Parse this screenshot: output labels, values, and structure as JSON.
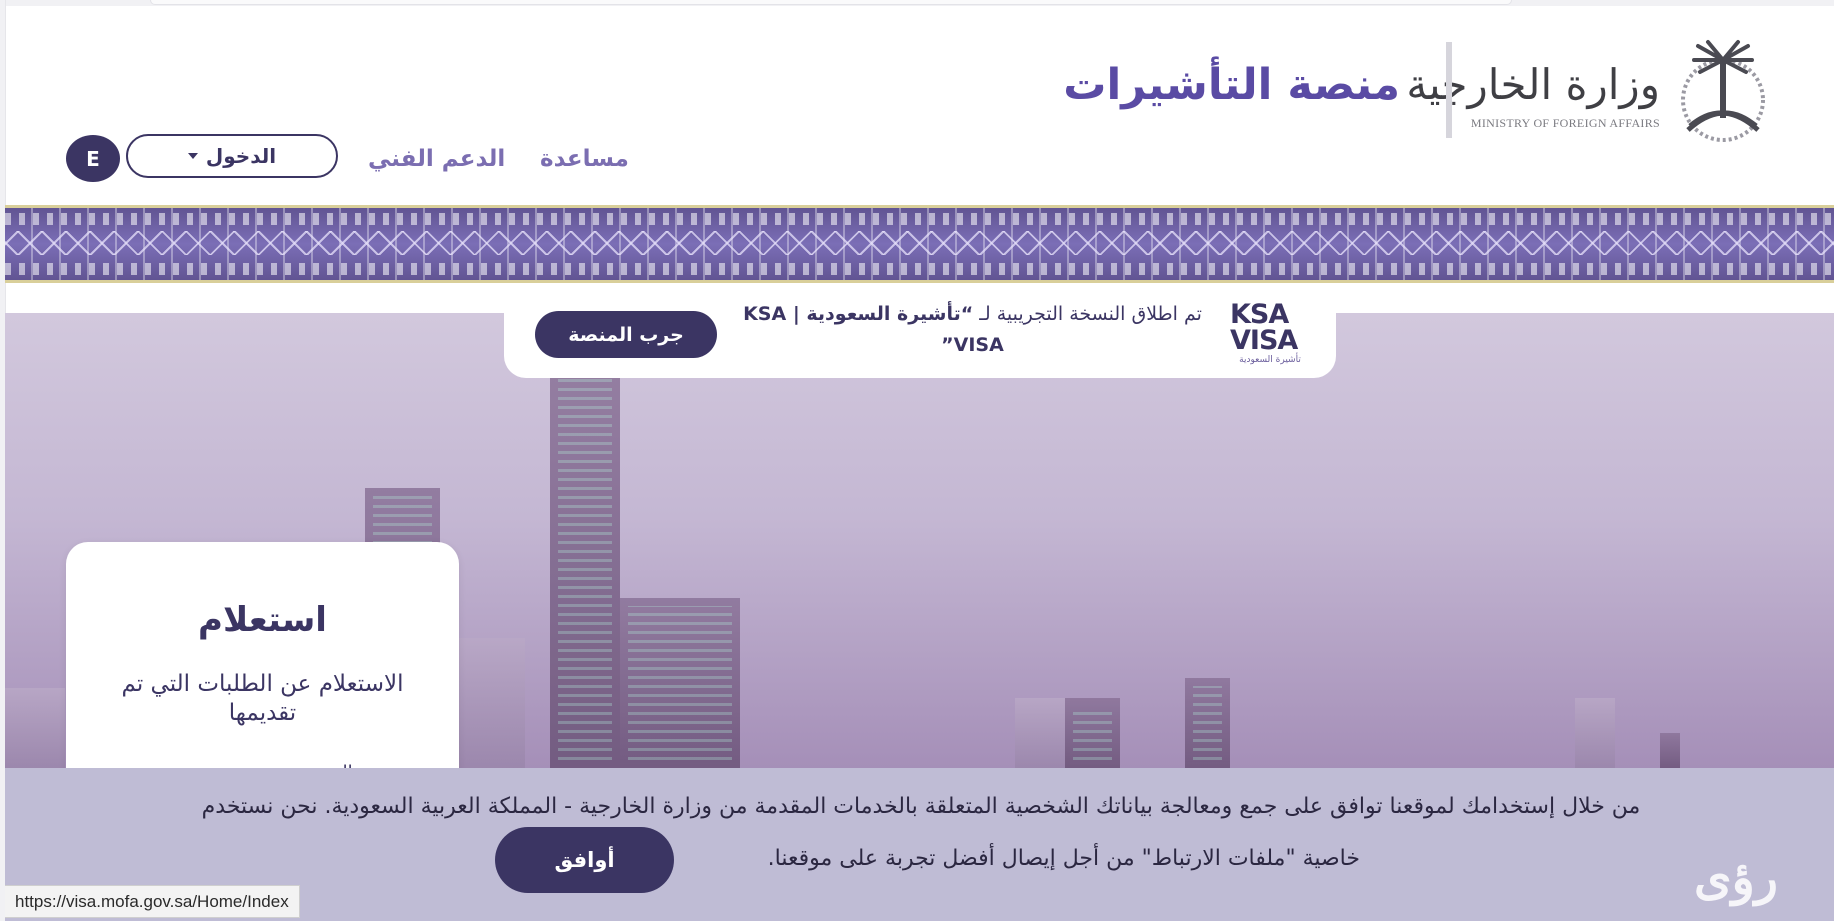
{
  "header": {
    "ministry_ar": "وزارة الخارجية",
    "ministry_en": "MINISTRY OF FOREIGN AFFAIRS",
    "platform_title": "منصة التأشيرات"
  },
  "nav": {
    "help": "مساعدة",
    "support": "الدعم الفني",
    "login": "الدخول",
    "language": "E"
  },
  "announcement": {
    "logo_line1": "KSA",
    "logo_line2": "VISA",
    "logo_sub": "تأشيرة السعودية",
    "text_plain": "تم اطلاق النسخة التجريبية لـ",
    "text_bold": "“تأشيرة السعودية | KSA VISA”",
    "cta": "جرب المنصة"
  },
  "inquiry": {
    "title": "استعلام",
    "description": "الاستعلام عن الطلبات التي تم تقديمها",
    "more": "المزيد"
  },
  "cookie": {
    "line1": "من خلال إستخدامك لموقعنا توافق على جمع ومعالجة بياناتك الشخصية المتعلقة بالخدمات المقدمة من وزارة الخارجية - المملكة العربية السعودية. نحن نستخدم",
    "line2": "خاصية \"ملفات الارتباط\" من أجل إيصال أفضل تجربة على موقعنا.",
    "agree": "أوافق"
  },
  "status_url": "https://visa.mofa.gov.sa/Home/Index",
  "watermark": "رؤى",
  "colors": {
    "primary": "#3b3563",
    "title_purple": "#5a4ba4",
    "nav_purple": "#7b6eb1",
    "cookie_bg": "#bfbcd5"
  }
}
